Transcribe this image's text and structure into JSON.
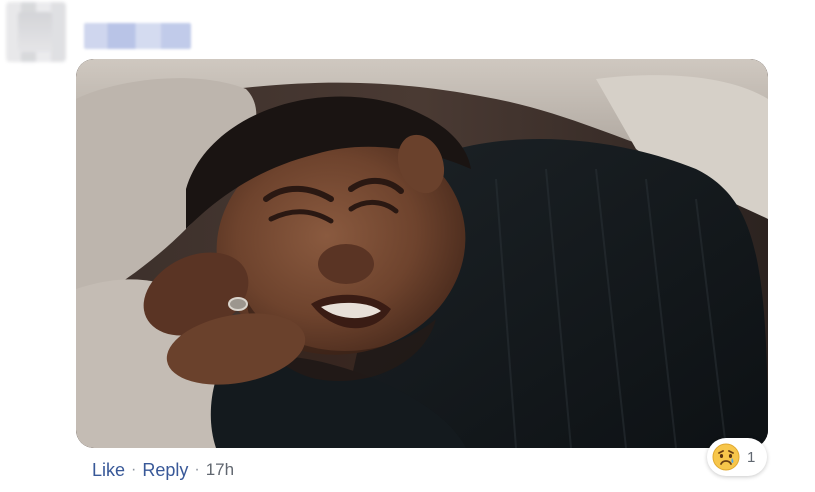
{
  "comment": {
    "actions": {
      "like_label": "Like",
      "separator": "·",
      "reply_label": "Reply",
      "timestamp": "17h"
    },
    "reaction": {
      "icon": "sad-face-icon",
      "count": "1"
    }
  }
}
